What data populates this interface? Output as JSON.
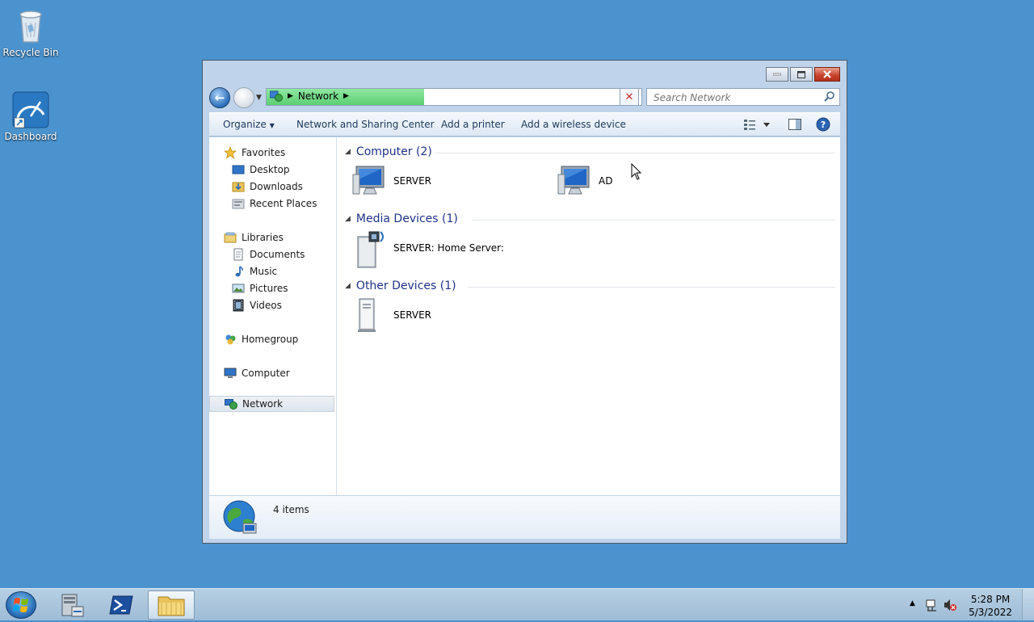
{
  "desktop": {
    "icons": [
      {
        "label": "Recycle Bin",
        "icon": "recycle-bin-icon"
      },
      {
        "label": "Dashboard",
        "icon": "dashboard-icon"
      }
    ]
  },
  "window": {
    "address": {
      "segments": [
        "Network"
      ],
      "progress_fraction": 0.42
    },
    "search": {
      "placeholder": "Search Network"
    },
    "toolbar": {
      "organize": "Organize",
      "network_sharing": "Network and Sharing Center",
      "add_printer": "Add a printer",
      "add_wireless": "Add a wireless device"
    },
    "nav": {
      "favorites": "Favorites",
      "desktop": "Desktop",
      "downloads": "Downloads",
      "recent": "Recent Places",
      "libraries": "Libraries",
      "documents": "Documents",
      "music": "Music",
      "pictures": "Pictures",
      "videos": "Videos",
      "homegroup": "Homegroup",
      "computer": "Computer",
      "network": "Network"
    },
    "groups": [
      {
        "header": "Computer (2)",
        "items": [
          "SERVER",
          "AD"
        ]
      },
      {
        "header": "Media Devices (1)",
        "items": [
          "SERVER: Home Server:"
        ]
      },
      {
        "header": "Other Devices (1)",
        "items": [
          "SERVER"
        ]
      }
    ],
    "details": {
      "count": "4 items"
    }
  },
  "taskbar": {
    "time": "5:28 PM",
    "date": "5/3/2022"
  },
  "colors": {
    "desktop": "#4a93cf",
    "group_header": "#1e3287",
    "address_progress": "#5ccf73"
  }
}
